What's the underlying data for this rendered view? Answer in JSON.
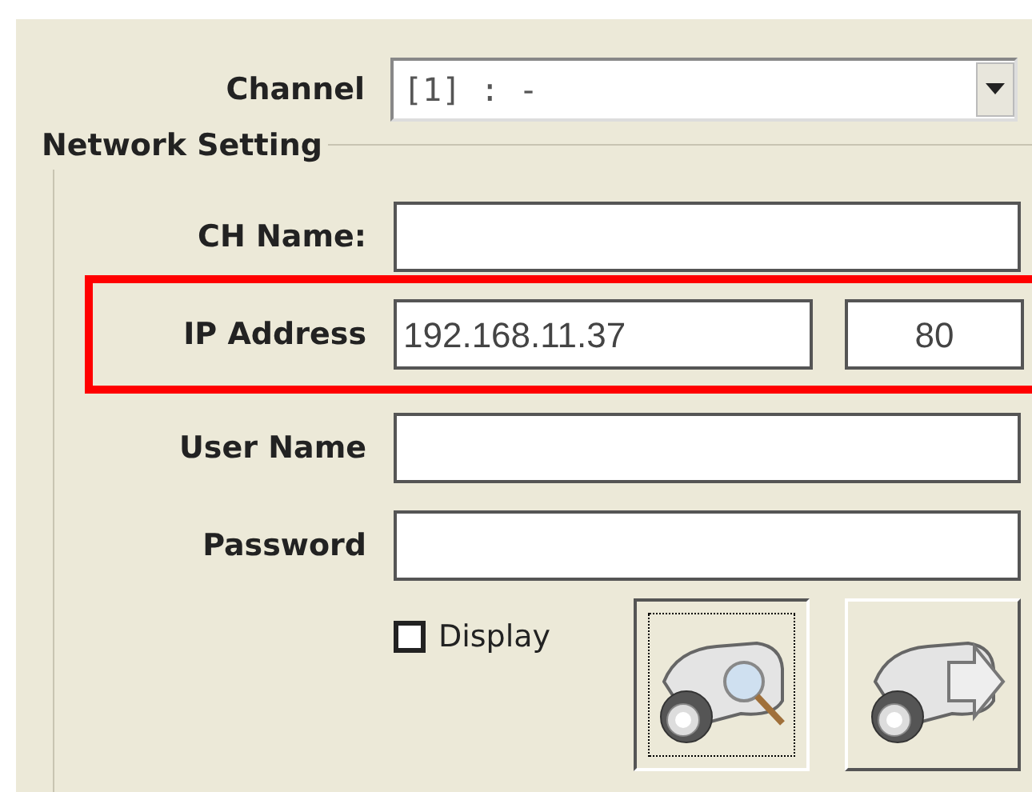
{
  "channel": {
    "label": "Channel",
    "value": "[1] : -"
  },
  "network_setting": {
    "legend": "Network Setting",
    "fields": [
      {
        "label": "CH Name:",
        "highlighted": false
      },
      {
        "label": "IP Address",
        "value": "192.168.11.37",
        "port": "80",
        "highlighted": true
      },
      {
        "label": "User Name",
        "highlighted": false
      },
      {
        "label": "Password",
        "highlighted": false
      }
    ],
    "display": {
      "label": "Display",
      "checked": false
    },
    "buttons": [
      {
        "kind": "search",
        "focused": true
      },
      {
        "kind": "connect",
        "focused": false
      }
    ]
  }
}
